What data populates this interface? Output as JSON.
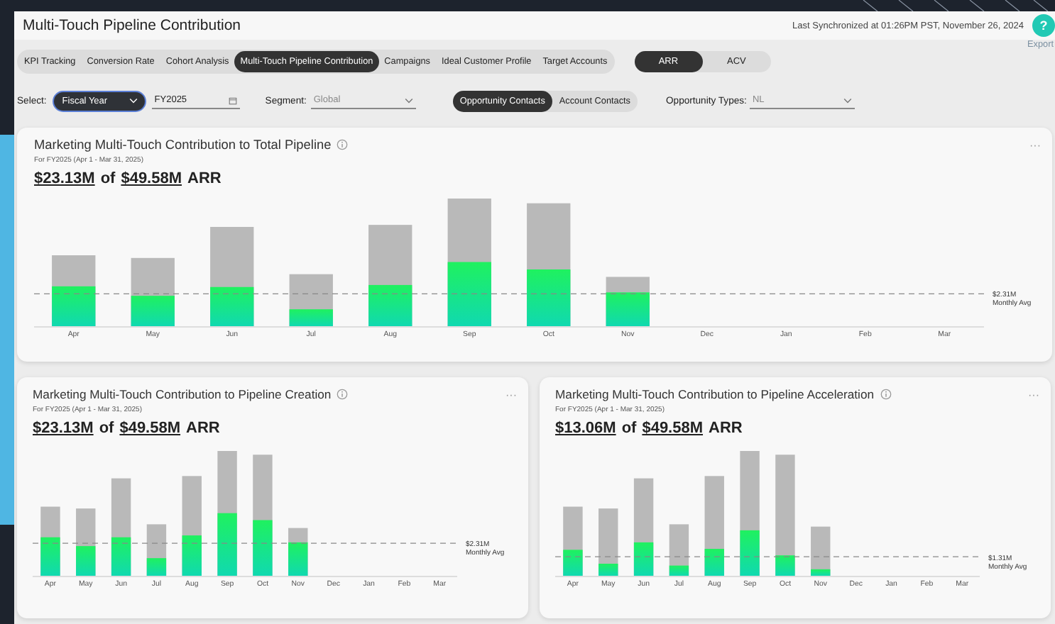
{
  "header": {
    "title": "Multi-Touch Pipeline Contribution",
    "sync": "Last Synchronized at 01:26PM PST, November 26, 2024",
    "help": "?"
  },
  "tabs": [
    {
      "label": "KPI Tracking",
      "selected": false
    },
    {
      "label": "Conversion Rate",
      "selected": false
    },
    {
      "label": "Cohort Analysis",
      "selected": false
    },
    {
      "label": "Multi-Touch Pipeline Contribution",
      "selected": true
    },
    {
      "label": "Campaigns",
      "selected": false
    },
    {
      "label": "Ideal Customer Profile",
      "selected": false
    },
    {
      "label": "Target Accounts",
      "selected": false
    }
  ],
  "metric_toggle": [
    {
      "label": "ARR",
      "selected": true
    },
    {
      "label": "ACV",
      "selected": false
    }
  ],
  "export": "Export",
  "filters": {
    "select_label": "Select:",
    "period_type": "Fiscal Year",
    "period": "FY2025",
    "segment_label": "Segment:",
    "segment": "Global",
    "contact_toggle": [
      {
        "label": "Opportunity Contacts",
        "selected": true
      },
      {
        "label": "Account Contacts",
        "selected": false
      }
    ],
    "opportunity_label": "Opportunity Types:",
    "opportunity": "NL"
  },
  "cards": [
    {
      "title": "Marketing Multi-Touch Contribution to Total Pipeline",
      "subtitle": "For FY2025 (Apr 1 - Mar 31, 2025)",
      "amount": "$23.13M",
      "connector": "of",
      "total": "$49.58M",
      "unit": "ARR",
      "menu": "···",
      "avg_value": "$2.31M",
      "avg_label": "Monthly Avg",
      "months": [
        "Apr",
        "May",
        "Jun",
        "Jul",
        "Aug",
        "Sep",
        "Oct",
        "Nov",
        "Dec",
        "Jan",
        "Feb",
        "Mar"
      ]
    },
    {
      "title": "Marketing Multi-Touch Contribution to Pipeline Creation",
      "subtitle": "For FY2025 (Apr 1 - Mar 31, 2025)",
      "amount": "$23.13M",
      "connector": "of",
      "total": "$49.58M",
      "unit": "ARR",
      "menu": "···",
      "avg_value": "$2.31M",
      "avg_label": "Monthly Avg",
      "months": [
        "Apr",
        "May",
        "Jun",
        "Jul",
        "Aug",
        "Sep",
        "Oct",
        "Nov",
        "Dec",
        "Jan",
        "Feb",
        "Mar"
      ]
    },
    {
      "title": "Marketing Multi-Touch Contribution to Pipeline Acceleration",
      "subtitle": "For FY2025 (Apr 1 - Mar 31, 2025)",
      "amount": "$13.06M",
      "connector": "of",
      "total": "$49.58M",
      "unit": "ARR",
      "menu": "···",
      "avg_value": "$1.31M",
      "avg_label": "Monthly Avg",
      "months": [
        "Apr",
        "May",
        "Jun",
        "Jul",
        "Aug",
        "Sep",
        "Oct",
        "Nov",
        "Dec",
        "Jan",
        "Feb",
        "Mar"
      ]
    }
  ]
}
